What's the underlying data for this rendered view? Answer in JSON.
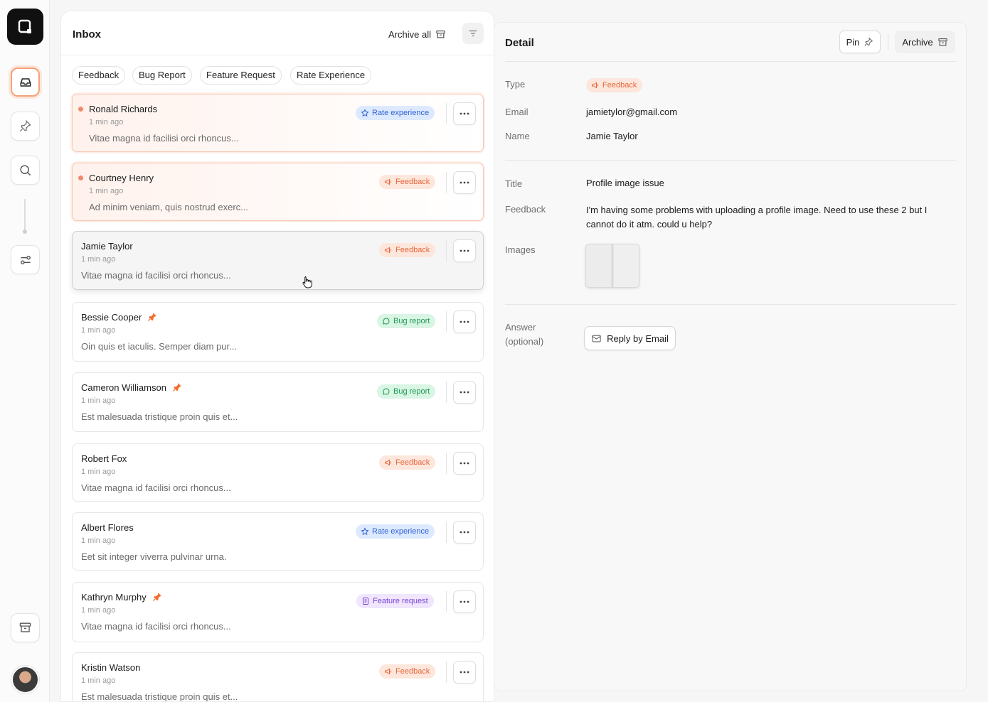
{
  "inbox": {
    "title": "Inbox",
    "archive_all_label": "Archive all",
    "filters": [
      "Feedback",
      "Bug Report",
      "Feature Request",
      "Rate Experience"
    ],
    "items": [
      {
        "name": "Ronald Richards",
        "time": "1 min ago",
        "preview": "Vitae magna id facilisi orci rhoncus...",
        "badge": "Rate experience",
        "badge_type": "rate",
        "unread": true,
        "pinned": false
      },
      {
        "name": "Courtney Henry",
        "time": "1 min ago",
        "preview": "Ad minim veniam, quis nostrud exerc...",
        "badge": "Feedback",
        "badge_type": "feedback",
        "unread": true,
        "pinned": false
      },
      {
        "name": "Jamie Taylor",
        "time": "1 min ago",
        "preview": "Vitae magna id facilisi orci rhoncus...",
        "badge": "Feedback",
        "badge_type": "feedback",
        "unread": false,
        "pinned": false,
        "hovered": true
      },
      {
        "name": "Bessie Cooper",
        "time": "1 min ago",
        "preview": "Oin quis et iaculis. Semper diam pur...",
        "badge": "Bug report",
        "badge_type": "bug",
        "unread": false,
        "pinned": true
      },
      {
        "name": "Cameron Williamson",
        "time": "1 min ago",
        "preview": "Est malesuada tristique proin quis et...",
        "badge": "Bug report",
        "badge_type": "bug",
        "unread": false,
        "pinned": true
      },
      {
        "name": "Robert Fox",
        "time": "1 min ago",
        "preview": "Vitae magna id facilisi orci rhoncus...",
        "badge": "Feedback",
        "badge_type": "feedback",
        "unread": false,
        "pinned": false
      },
      {
        "name": "Albert Flores",
        "time": "1 min ago",
        "preview": "Eet sit integer viverra pulvinar urna.",
        "badge": "Rate experience",
        "badge_type": "rate",
        "unread": false,
        "pinned": false
      },
      {
        "name": "Kathryn Murphy",
        "time": "1 min ago",
        "preview": "Vitae magna id facilisi orci rhoncus...",
        "badge": "Feature request",
        "badge_type": "feature",
        "unread": false,
        "pinned": true
      },
      {
        "name": "Kristin Watson",
        "time": "1 min ago",
        "preview": "Est malesuada tristique proin quis et...",
        "badge": "Feedback",
        "badge_type": "feedback",
        "unread": false,
        "pinned": false
      }
    ]
  },
  "detail": {
    "title": "Detail",
    "pin_label": "Pin",
    "archive_label": "Archive",
    "type_label": "Type",
    "type_value": "Feedback",
    "email_label": "Email",
    "email_value": "jamietylor@gmail.com",
    "name_label": "Name",
    "name_value": "Jamie Taylor",
    "title_label": "Title",
    "title_value": "Profile image issue",
    "feedback_label": "Feedback",
    "feedback_value": "I'm having some problems with uploading a profile image. Need to use these 2 but I cannot do it atm. could u help?",
    "images_label": "Images",
    "answer_label_1": "Answer",
    "answer_label_2": "(optional)",
    "reply_label": "Reply by Email"
  },
  "colors": {
    "accent": "#f08a6a",
    "rate": "#2f63d8",
    "feedback": "#e8673d",
    "bug": "#1f9a57",
    "feature": "#7a45d8"
  }
}
